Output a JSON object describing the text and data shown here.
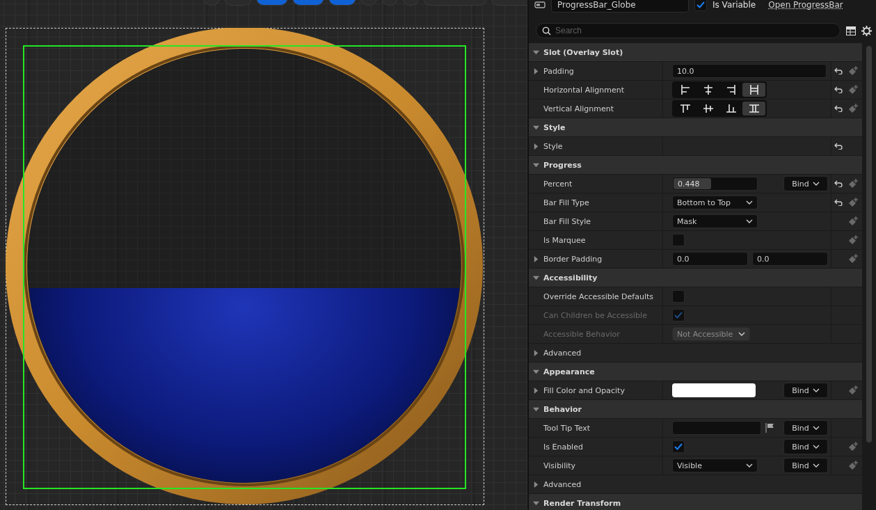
{
  "canvas": {
    "globe": {
      "level": 0.448
    },
    "toolbar": [
      {
        "kind": "round",
        "selected": false
      },
      {
        "kind": "pill",
        "selected": false
      },
      {
        "kind": "pair",
        "selected": true
      },
      {
        "kind": "pair",
        "selected": true
      },
      {
        "kind": "pill",
        "selected": true
      },
      {
        "kind": "round",
        "selected": false
      },
      {
        "kind": "round",
        "selected": false
      },
      {
        "kind": "round",
        "selected": false
      },
      {
        "kind": "wide",
        "selected": false
      },
      {
        "kind": "wide",
        "selected": false
      }
    ]
  },
  "details": {
    "name": "ProgressBar_Globe",
    "is_variable": {
      "label": "Is Variable",
      "checked": true
    },
    "open_link": "Open ProgressBar",
    "search": {
      "placeholder": "Search"
    },
    "sections": [
      {
        "title": "Slot (Overlay Slot)",
        "expanded": true,
        "rows": [
          {
            "label": "Padding",
            "kind": "text",
            "expandable": true,
            "value": "10.0",
            "reset": true,
            "keyframe": true
          },
          {
            "label": "Horizontal Alignment",
            "kind": "align",
            "options": [
              {
                "kind": "left",
                "selected": false
              },
              {
                "kind": "center",
                "selected": false
              },
              {
                "kind": "right",
                "selected": false
              },
              {
                "kind": "fill",
                "selected": true
              }
            ],
            "reset": true,
            "keyframe": true
          },
          {
            "label": "Vertical Alignment",
            "kind": "align",
            "options": [
              {
                "kind": "top",
                "selected": false
              },
              {
                "kind": "middle",
                "selected": false
              },
              {
                "kind": "bottom",
                "selected": false
              },
              {
                "kind": "vfill",
                "selected": true
              }
            ],
            "reset": true,
            "keyframe": true
          }
        ]
      },
      {
        "title": "Style",
        "expanded": true,
        "rows": [
          {
            "label": "Style",
            "kind": "empty",
            "expandable": true,
            "reset": true
          }
        ]
      },
      {
        "title": "Progress",
        "expanded": true,
        "rows": [
          {
            "label": "Percent",
            "kind": "slider",
            "value": "0.448",
            "level": 0.448,
            "bind": "Bind",
            "reset": true,
            "keyframe": true
          },
          {
            "label": "Bar Fill Type",
            "kind": "dropdown",
            "value": "Bottom to Top",
            "reset": true,
            "keyframe": true
          },
          {
            "label": "Bar Fill Style",
            "kind": "dropdown",
            "value": "Mask",
            "keyframe": true
          },
          {
            "label": "Is Marquee",
            "kind": "checkbox",
            "checked": false,
            "keyframe": true
          },
          {
            "label": "Border Padding",
            "kind": "pair",
            "expandable": true,
            "values": [
              "0.0",
              "0.0"
            ],
            "keyframe": true
          }
        ]
      },
      {
        "title": "Accessibility",
        "expanded": true,
        "rows": [
          {
            "label": "Override Accessible Defaults",
            "kind": "checkbox",
            "checked": false
          },
          {
            "label": "Can Children be Accessible",
            "kind": "checkbox",
            "checked": true,
            "disabled": true
          },
          {
            "label": "Accessible Behavior",
            "kind": "small-dropdown",
            "value": "Not Accessible",
            "disabled": true
          },
          {
            "label": "Advanced",
            "kind": "group",
            "expandable": true
          }
        ]
      },
      {
        "title": "Appearance",
        "expanded": true,
        "rows": [
          {
            "label": "Fill Color and Opacity",
            "kind": "color",
            "expandable": true,
            "color": "#ffffff",
            "bind": "Bind",
            "keyframe": true
          }
        ]
      },
      {
        "title": "Behavior",
        "expanded": true,
        "rows": [
          {
            "label": "Tool Tip Text",
            "kind": "localized-text",
            "bind": "Bind"
          },
          {
            "label": "Is Enabled",
            "kind": "checkbox",
            "checked": true,
            "bind": "Bind",
            "keyframe": true
          },
          {
            "label": "Visibility",
            "kind": "dropdown",
            "value": "Visible",
            "bind": "Bind",
            "keyframe": true
          },
          {
            "label": "Advanced",
            "kind": "group",
            "expandable": true
          }
        ]
      },
      {
        "title": "Render Transform",
        "expanded": true
      }
    ]
  }
}
